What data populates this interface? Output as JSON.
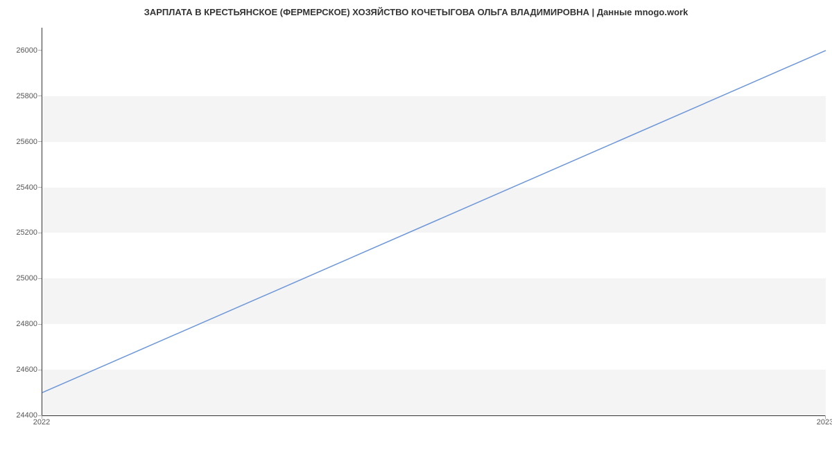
{
  "chart_data": {
    "type": "line",
    "title": "ЗАРПЛАТА В КРЕСТЬЯНСКОЕ (ФЕРМЕРСКОЕ) ХОЗЯЙСТВО КОЧЕТЫГОВА ОЛЬГА ВЛАДИМИРОВНА | Данные mnogo.work",
    "x": [
      "2022",
      "2023"
    ],
    "values": [
      24500,
      26000
    ],
    "xlabel": "",
    "ylabel": "",
    "ylim": [
      24400,
      26100
    ],
    "y_ticks": [
      24400,
      24600,
      24800,
      25000,
      25200,
      25400,
      25600,
      25800,
      26000
    ],
    "x_ticks": [
      "2022",
      "2023"
    ],
    "line_color": "#6c96d9",
    "band_color": "#f4f4f4"
  }
}
